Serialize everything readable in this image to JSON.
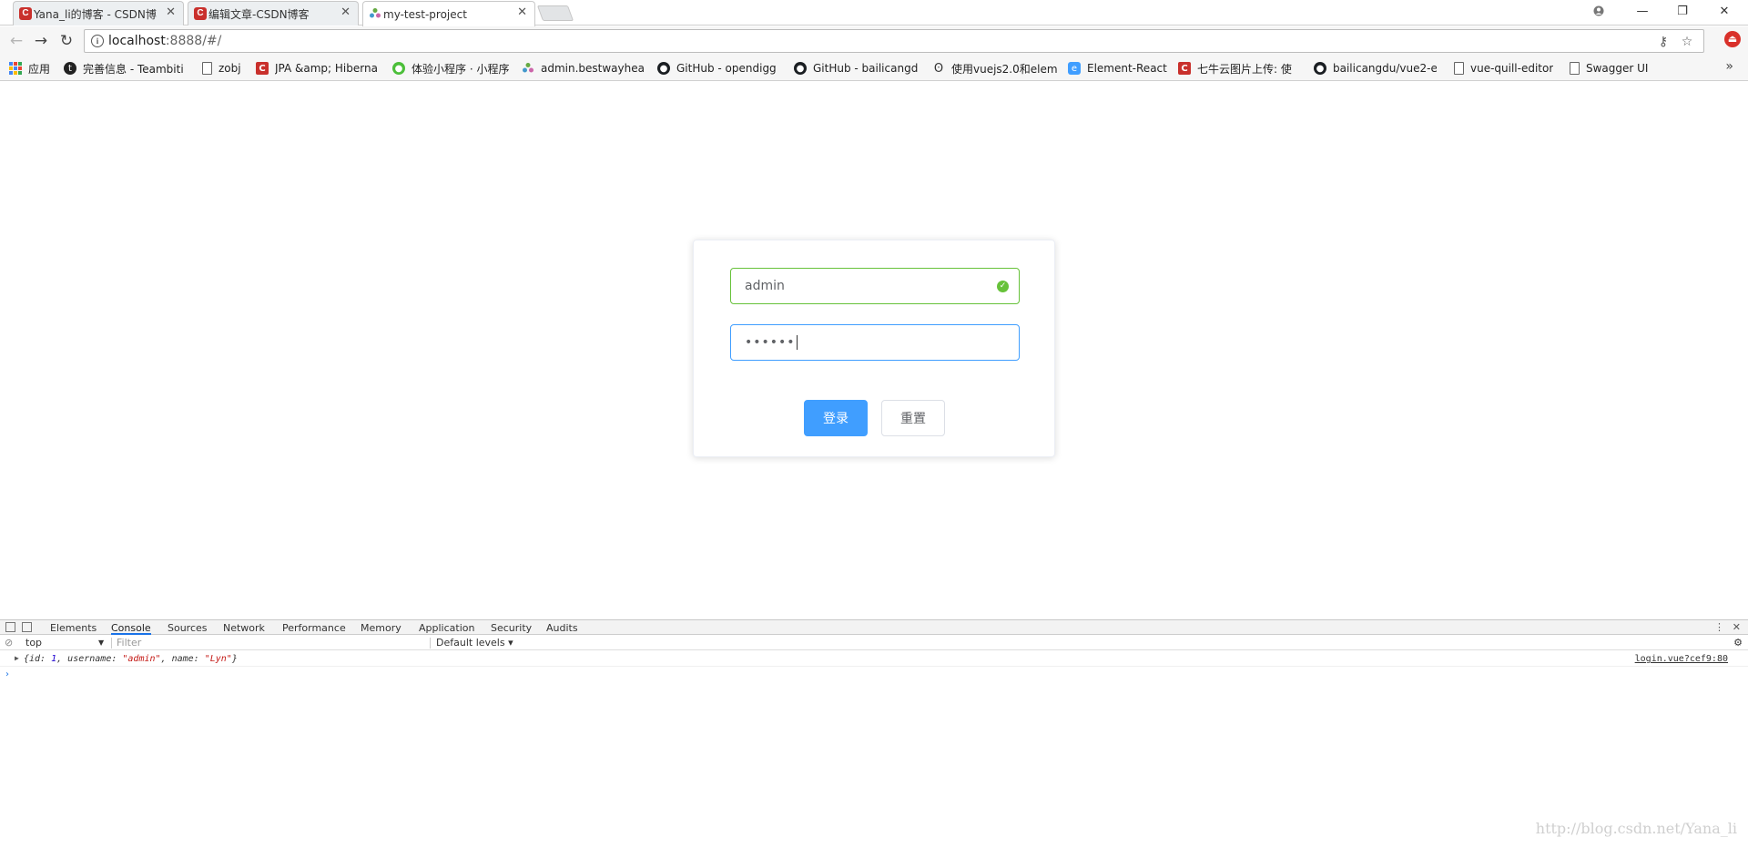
{
  "browser": {
    "tabs": [
      {
        "title": "Yana_li的博客 - CSDN博",
        "icon": "csdn-icon",
        "active": false
      },
      {
        "title": "编辑文章-CSDN博客",
        "icon": "csdn-icon",
        "active": false
      },
      {
        "title": "my-test-project",
        "icon": "vue-icon",
        "active": true
      }
    ],
    "address": {
      "host": "localhost",
      "rest": ":8888/#/"
    },
    "bookmarks": [
      {
        "label": "应用",
        "icon": "apps-icon"
      },
      {
        "label": "完善信息 - Teambiti",
        "icon": "teambition-icon"
      },
      {
        "label": "zobj",
        "icon": "page-icon"
      },
      {
        "label": "JPA &amp; Hiberna",
        "icon": "csdn-icon"
      },
      {
        "label": "体验小程序 · 小程序",
        "icon": "wechat-icon"
      },
      {
        "label": "admin.bestwayheal",
        "icon": "vue-icon"
      },
      {
        "label": "GitHub - opendigg",
        "icon": "github-icon"
      },
      {
        "label": "GitHub - bailicangd",
        "icon": "github-icon"
      },
      {
        "label": "使用vuejs2.0和elem",
        "icon": "wave-icon"
      },
      {
        "label": "Element-React",
        "icon": "element-icon"
      },
      {
        "label": "七牛云图片上传: 使",
        "icon": "csdn-icon"
      },
      {
        "label": "bailicangdu/vue2-e",
        "icon": "github-icon"
      },
      {
        "label": "vue-quill-editor",
        "icon": "page-icon"
      },
      {
        "label": "Swagger UI",
        "icon": "page-icon"
      }
    ]
  },
  "login": {
    "username": "admin",
    "password_mask": "••••••",
    "login_label": "登录",
    "reset_label": "重置"
  },
  "devtools": {
    "tabs": [
      "Elements",
      "Console",
      "Sources",
      "Network",
      "Performance",
      "Memory",
      "Application",
      "Security",
      "Audits"
    ],
    "active_tab": "Console",
    "context": "top",
    "filter_placeholder": "Filter",
    "levels": "Default levels ▾",
    "log": {
      "open": "{id: ",
      "id": "1",
      "k2": ", username: ",
      "username": "\"admin\"",
      "k3": ", name: ",
      "name": "\"Lyn\"",
      "close": "}",
      "source": "login.vue?cef9:80"
    }
  },
  "watermark": "http://blog.csdn.net/Yana_li",
  "colors": {
    "primary": "#409eff",
    "success": "#67c23a",
    "csdn": "#c9302c"
  }
}
